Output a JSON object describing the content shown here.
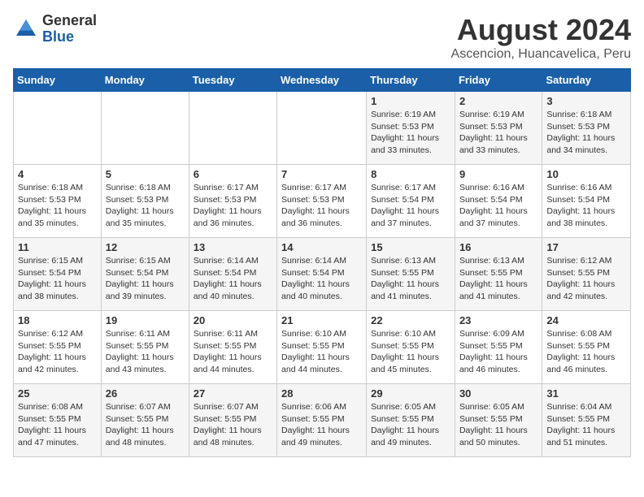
{
  "logo": {
    "general": "General",
    "blue": "Blue"
  },
  "title": {
    "month_year": "August 2024",
    "location": "Ascencion, Huancavelica, Peru"
  },
  "headers": [
    "Sunday",
    "Monday",
    "Tuesday",
    "Wednesday",
    "Thursday",
    "Friday",
    "Saturday"
  ],
  "weeks": [
    [
      {
        "day": "",
        "info": ""
      },
      {
        "day": "",
        "info": ""
      },
      {
        "day": "",
        "info": ""
      },
      {
        "day": "",
        "info": ""
      },
      {
        "day": "1",
        "info": "Sunrise: 6:19 AM\nSunset: 5:53 PM\nDaylight: 11 hours\nand 33 minutes."
      },
      {
        "day": "2",
        "info": "Sunrise: 6:19 AM\nSunset: 5:53 PM\nDaylight: 11 hours\nand 33 minutes."
      },
      {
        "day": "3",
        "info": "Sunrise: 6:18 AM\nSunset: 5:53 PM\nDaylight: 11 hours\nand 34 minutes."
      }
    ],
    [
      {
        "day": "4",
        "info": "Sunrise: 6:18 AM\nSunset: 5:53 PM\nDaylight: 11 hours\nand 35 minutes."
      },
      {
        "day": "5",
        "info": "Sunrise: 6:18 AM\nSunset: 5:53 PM\nDaylight: 11 hours\nand 35 minutes."
      },
      {
        "day": "6",
        "info": "Sunrise: 6:17 AM\nSunset: 5:53 PM\nDaylight: 11 hours\nand 36 minutes."
      },
      {
        "day": "7",
        "info": "Sunrise: 6:17 AM\nSunset: 5:53 PM\nDaylight: 11 hours\nand 36 minutes."
      },
      {
        "day": "8",
        "info": "Sunrise: 6:17 AM\nSunset: 5:54 PM\nDaylight: 11 hours\nand 37 minutes."
      },
      {
        "day": "9",
        "info": "Sunrise: 6:16 AM\nSunset: 5:54 PM\nDaylight: 11 hours\nand 37 minutes."
      },
      {
        "day": "10",
        "info": "Sunrise: 6:16 AM\nSunset: 5:54 PM\nDaylight: 11 hours\nand 38 minutes."
      }
    ],
    [
      {
        "day": "11",
        "info": "Sunrise: 6:15 AM\nSunset: 5:54 PM\nDaylight: 11 hours\nand 38 minutes."
      },
      {
        "day": "12",
        "info": "Sunrise: 6:15 AM\nSunset: 5:54 PM\nDaylight: 11 hours\nand 39 minutes."
      },
      {
        "day": "13",
        "info": "Sunrise: 6:14 AM\nSunset: 5:54 PM\nDaylight: 11 hours\nand 40 minutes."
      },
      {
        "day": "14",
        "info": "Sunrise: 6:14 AM\nSunset: 5:54 PM\nDaylight: 11 hours\nand 40 minutes."
      },
      {
        "day": "15",
        "info": "Sunrise: 6:13 AM\nSunset: 5:55 PM\nDaylight: 11 hours\nand 41 minutes."
      },
      {
        "day": "16",
        "info": "Sunrise: 6:13 AM\nSunset: 5:55 PM\nDaylight: 11 hours\nand 41 minutes."
      },
      {
        "day": "17",
        "info": "Sunrise: 6:12 AM\nSunset: 5:55 PM\nDaylight: 11 hours\nand 42 minutes."
      }
    ],
    [
      {
        "day": "18",
        "info": "Sunrise: 6:12 AM\nSunset: 5:55 PM\nDaylight: 11 hours\nand 42 minutes."
      },
      {
        "day": "19",
        "info": "Sunrise: 6:11 AM\nSunset: 5:55 PM\nDaylight: 11 hours\nand 43 minutes."
      },
      {
        "day": "20",
        "info": "Sunrise: 6:11 AM\nSunset: 5:55 PM\nDaylight: 11 hours\nand 44 minutes."
      },
      {
        "day": "21",
        "info": "Sunrise: 6:10 AM\nSunset: 5:55 PM\nDaylight: 11 hours\nand 44 minutes."
      },
      {
        "day": "22",
        "info": "Sunrise: 6:10 AM\nSunset: 5:55 PM\nDaylight: 11 hours\nand 45 minutes."
      },
      {
        "day": "23",
        "info": "Sunrise: 6:09 AM\nSunset: 5:55 PM\nDaylight: 11 hours\nand 46 minutes."
      },
      {
        "day": "24",
        "info": "Sunrise: 6:08 AM\nSunset: 5:55 PM\nDaylight: 11 hours\nand 46 minutes."
      }
    ],
    [
      {
        "day": "25",
        "info": "Sunrise: 6:08 AM\nSunset: 5:55 PM\nDaylight: 11 hours\nand 47 minutes."
      },
      {
        "day": "26",
        "info": "Sunrise: 6:07 AM\nSunset: 5:55 PM\nDaylight: 11 hours\nand 48 minutes."
      },
      {
        "day": "27",
        "info": "Sunrise: 6:07 AM\nSunset: 5:55 PM\nDaylight: 11 hours\nand 48 minutes."
      },
      {
        "day": "28",
        "info": "Sunrise: 6:06 AM\nSunset: 5:55 PM\nDaylight: 11 hours\nand 49 minutes."
      },
      {
        "day": "29",
        "info": "Sunrise: 6:05 AM\nSunset: 5:55 PM\nDaylight: 11 hours\nand 49 minutes."
      },
      {
        "day": "30",
        "info": "Sunrise: 6:05 AM\nSunset: 5:55 PM\nDaylight: 11 hours\nand 50 minutes."
      },
      {
        "day": "31",
        "info": "Sunrise: 6:04 AM\nSunset: 5:55 PM\nDaylight: 11 hours\nand 51 minutes."
      }
    ]
  ]
}
